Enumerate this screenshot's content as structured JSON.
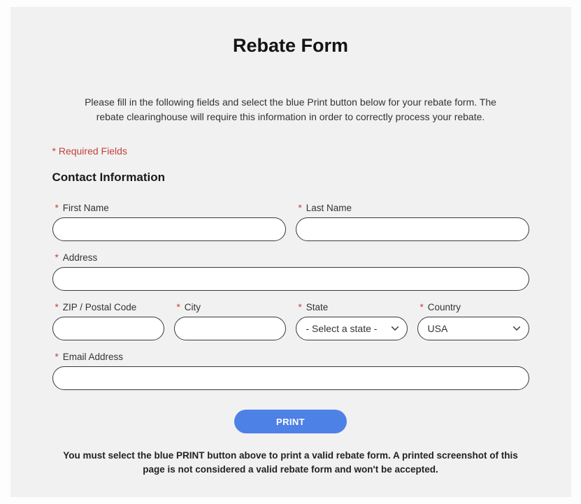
{
  "title": "Rebate Form",
  "intro": "Please fill in the following fields and select the blue Print button below for your rebate form. The rebate clearinghouse will require this information in order to correctly process your rebate.",
  "required_note": "* Required Fields",
  "section_heading": "Contact Information",
  "fields": {
    "first_name": {
      "label": "First Name",
      "value": ""
    },
    "last_name": {
      "label": "Last Name",
      "value": ""
    },
    "address": {
      "label": "Address",
      "value": ""
    },
    "zip": {
      "label": "ZIP / Postal Code",
      "value": ""
    },
    "city": {
      "label": "City",
      "value": ""
    },
    "state": {
      "label": "State",
      "placeholder": "- Select a state -",
      "value": ""
    },
    "country": {
      "label": "Country",
      "value": "USA"
    },
    "email": {
      "label": "Email Address",
      "value": ""
    }
  },
  "print_label": "PRINT",
  "footer_note": "You must select the blue PRINT button above to print a valid rebate form. A printed screenshot of this page is not considered a valid rebate form and won't be accepted."
}
